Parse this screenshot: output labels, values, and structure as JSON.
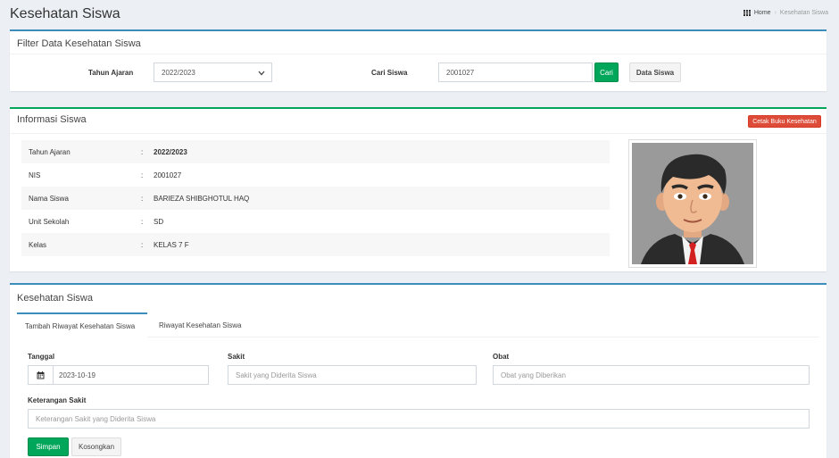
{
  "page": {
    "title": "Kesehatan Siswa",
    "breadcrumb": {
      "home": "Home",
      "current": "Kesehatan Siswa"
    }
  },
  "filter": {
    "title": "Filter Data Kesehatan Siswa",
    "year_label": "Tahun Ajaran",
    "year_value": "2022/2023",
    "search_label": "Cari Siswa",
    "search_value": "2001027",
    "search_button": "Cari",
    "data_button": "Data Siswa"
  },
  "info": {
    "title": "Informasi Siswa",
    "print_button": "Cetak Buku Kesehatan",
    "rows": [
      {
        "label": "Tahun Ajaran",
        "value": "2022/2023"
      },
      {
        "label": "NIS",
        "value": "2001027"
      },
      {
        "label": "Nama Siswa",
        "value": "BARIEZA SHIBGHOTUL HAQ"
      },
      {
        "label": "Unit Sekolah",
        "value": "SD"
      },
      {
        "label": "Kelas",
        "value": "KELAS 7 F"
      }
    ],
    "colon": ":"
  },
  "health": {
    "title": "Kesehatan Siswa",
    "tabs": [
      {
        "label": "Tambah Riwayat Kesehatan Siswa"
      },
      {
        "label": "Riwayat Kesehatan Siswa"
      }
    ],
    "date_label": "Tanggal",
    "date_value": "2023-10-19",
    "sick_label": "Sakit",
    "sick_placeholder": "Sakit yang Diderita Siswa",
    "medicine_label": "Obat",
    "medicine_placeholder": "Obat yang Diberikan",
    "note_label": "Keterangan Sakit",
    "note_placeholder": "Keterangan Sakit yang Diderita Siswa",
    "save_button": "Simpan",
    "clear_button": "Kosongkan"
  },
  "colors": {
    "primary": "#3c8dbc",
    "success": "#00a65a",
    "danger": "#dd4b39"
  }
}
